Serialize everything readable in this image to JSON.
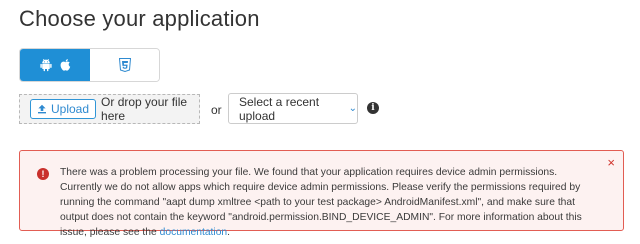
{
  "page": {
    "title": "Choose your application"
  },
  "platform_switch": {
    "options": [
      {
        "name": "android-apple",
        "icons": [
          "android-icon",
          "apple-icon"
        ],
        "selected": true
      },
      {
        "name": "html5",
        "icons": [
          "html5-icon"
        ],
        "selected": false
      }
    ],
    "accent": "#1f8fd6"
  },
  "upload": {
    "button_label": "Upload",
    "drop_text": "Or drop your file here",
    "or_text": "or",
    "recent_label": "Select a recent upload"
  },
  "error": {
    "message": "There was a problem processing your file. We found that your application requires device admin permissions. Currently we do not allow apps which require device admin permissions. Please verify the permissions required by running the command \"aapt dump xmltree <path to your test package> AndroidManifest.xml\", and make sure that output does not contain the keyword \"android.permission.BIND_DEVICE_ADMIN\". For more information about this issue, please see the ",
    "link_text": "documentation",
    "trailing": ".",
    "close_glyph": "×",
    "color": "#e25d53"
  }
}
